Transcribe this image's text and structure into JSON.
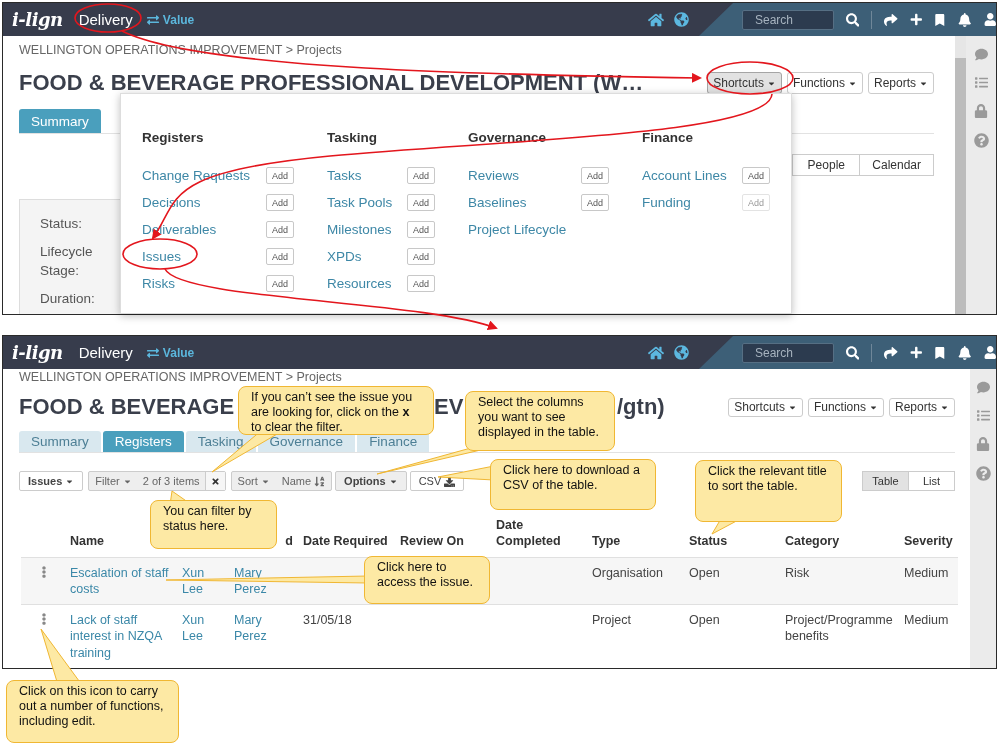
{
  "top_screen": {
    "navbar": {
      "logo": "i-lign",
      "app": "Delivery",
      "switch": "Value",
      "search_placeholder": "Search"
    },
    "breadcrumb": "WELLINGTON OPERATIONS IMPROVEMENT > Projects",
    "title": "FOOD & BEVERAGE PROFESSIONAL DEVELOPMENT (W…",
    "header_buttons": [
      {
        "label": "Shortcuts",
        "selected": true
      },
      {
        "label": "Functions",
        "selected": false
      },
      {
        "label": "Reports",
        "selected": false
      }
    ],
    "tabs": [
      {
        "label": "Summary",
        "selected": true
      }
    ],
    "view_buttons": [
      "People",
      "Calendar"
    ],
    "fields": [
      "Status:",
      "Lifecycle Stage:",
      "Duration:"
    ],
    "shortcuts_menu": {
      "columns": [
        {
          "heading": "Registers",
          "items": [
            {
              "label": "Change Requests",
              "add": "Add",
              "disabled": false
            },
            {
              "label": "Decisions",
              "add": "Add",
              "disabled": false
            },
            {
              "label": "Deliverables",
              "add": "Add",
              "disabled": false
            },
            {
              "label": "Issues",
              "add": "Add",
              "disabled": false
            },
            {
              "label": "Risks",
              "add": "Add",
              "disabled": false
            }
          ]
        },
        {
          "heading": "Tasking",
          "items": [
            {
              "label": "Tasks",
              "add": "Add",
              "disabled": false
            },
            {
              "label": "Task Pools",
              "add": "Add",
              "disabled": false
            },
            {
              "label": "Milestones",
              "add": "Add",
              "disabled": false
            },
            {
              "label": "XPDs",
              "add": "Add",
              "disabled": false
            },
            {
              "label": "Resources",
              "add": "Add",
              "disabled": false
            }
          ]
        },
        {
          "heading": "Governance",
          "items": [
            {
              "label": "Reviews",
              "add": "Add",
              "disabled": false
            },
            {
              "label": "Baselines",
              "add": "Add",
              "disabled": false
            },
            {
              "label": "Project Lifecycle"
            }
          ]
        },
        {
          "heading": "Finance",
          "items": [
            {
              "label": "Account Lines",
              "add": "Add",
              "disabled": false
            },
            {
              "label": "Funding",
              "add": "Add",
              "disabled": true
            }
          ]
        }
      ]
    }
  },
  "bottom_screen": {
    "navbar": {
      "logo": "i-lign",
      "app": "Delivery",
      "switch": "Value",
      "search_placeholder": "Search"
    },
    "breadcrumb": "WELLINGTON OPERATIONS IMPROVEMENT > Projects",
    "title_parts": [
      "FOOD & BEVERAGE",
      "EV",
      "/gtn)"
    ],
    "header_buttons": [
      {
        "label": "Shortcuts",
        "selected": false
      },
      {
        "label": "Functions",
        "selected": false
      },
      {
        "label": "Reports",
        "selected": false
      }
    ],
    "tabs": [
      {
        "label": "Summary",
        "selected": false
      },
      {
        "label": "Registers",
        "selected": true
      },
      {
        "label": "Tasking",
        "selected": false
      },
      {
        "label": "Governance",
        "selected": false
      },
      {
        "label": "Finance",
        "selected": false
      }
    ],
    "toolbar": {
      "register": "Issues",
      "filter": "Filter",
      "filter_summary": "2 of 3 items",
      "sort": "Sort",
      "sort_field": "Name",
      "options": "Options",
      "csv": "CSV",
      "views": [
        {
          "label": "Table",
          "selected": true
        },
        {
          "label": "List",
          "selected": false
        }
      ]
    },
    "table": {
      "columns": [
        {
          "label": "Name"
        },
        {},
        {
          "label": "d"
        },
        {
          "label": "Date Required"
        },
        {
          "label": "Review On"
        },
        {
          "label": "Date Completed"
        },
        {
          "label": "Type"
        },
        {
          "label": "Status"
        },
        {
          "label": "Category"
        },
        {
          "label": "Severity"
        }
      ],
      "rows": [
        {
          "cells": [
            "Escalation of staff costs",
            "Xun Lee",
            "Mary Perez",
            null,
            null,
            null,
            "Organisation",
            "Open",
            "Risk",
            "Medium"
          ]
        },
        {
          "cells": [
            "Lack of staff interest in NZQA training",
            "Xun Lee",
            "Mary Perez",
            "31/05/18",
            null,
            null,
            "Project",
            "Open",
            "Project/Programme benefits",
            "Medium"
          ]
        }
      ]
    }
  },
  "callouts": [
    {
      "text": "If you can’t see the issue you are looking for, click on the **x** to clear the filter."
    },
    {
      "text": "Select the columns you want to see displayed in the table."
    },
    {
      "text": "Click here to download a CSV of the table."
    },
    {
      "text": "Click the relevant title to sort the table."
    },
    {
      "text": "You can filter by status here."
    },
    {
      "text": "Click here to access the issue."
    },
    {
      "text": "Click on this icon to carry out a number of functions, including edit."
    }
  ]
}
